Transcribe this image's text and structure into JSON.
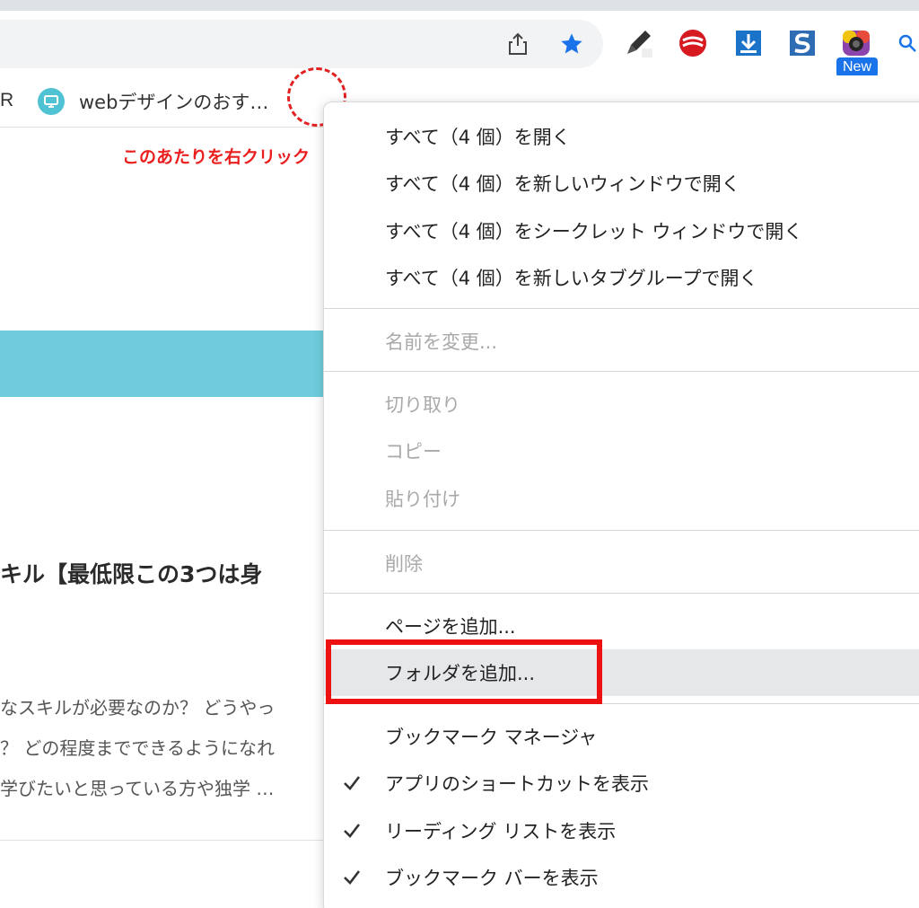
{
  "chrome": {
    "colors": {
      "accent": "#1a73e8",
      "star": "#1a73e8",
      "annotation_red": "#ea1e1e"
    },
    "omnibox_icons": [
      "share-icon",
      "star-icon"
    ],
    "extensions": [
      "eyedropper-icon",
      "trend-micro-icon",
      "download-extension-icon",
      "s-extension-icon",
      "camera-extension-icon",
      "search-icon"
    ],
    "new_badge": "New"
  },
  "bookmarks_bar": {
    "partial_item": "R",
    "items": [
      {
        "label": "webデザインのおす…",
        "icon": "monitor-favicon-icon"
      }
    ]
  },
  "page": {
    "annotation": "このあたりを右クリック",
    "article_title": "キル【最低限この3つは身",
    "excerpt": [
      "なスキルが必要なのか？ どうやっ",
      "？ どの程度までできるようになれ",
      "学びたいと思っている方や独学 …"
    ]
  },
  "context_menu": {
    "open_all": "すべて（4 個）を開く",
    "open_all_new_window": "すべて（4 個）を新しいウィンドウで開く",
    "open_all_incognito": "すべて（4 個）をシークレット ウィンドウで開く",
    "open_all_tab_group": "すべて（4 個）を新しいタブグループで開く",
    "rename": "名前を変更...",
    "cut": "切り取り",
    "copy": "コピー",
    "paste": "貼り付け",
    "delete": "削除",
    "add_page": "ページを追加...",
    "add_folder": "フォルダを追加...",
    "bookmark_manager": "ブックマーク マネージャ",
    "show_apps_shortcut": "アプリのショートカットを表示",
    "show_reading_list": "リーディング リストを表示",
    "show_bookmarks_bar": "ブックマーク バーを表示"
  }
}
